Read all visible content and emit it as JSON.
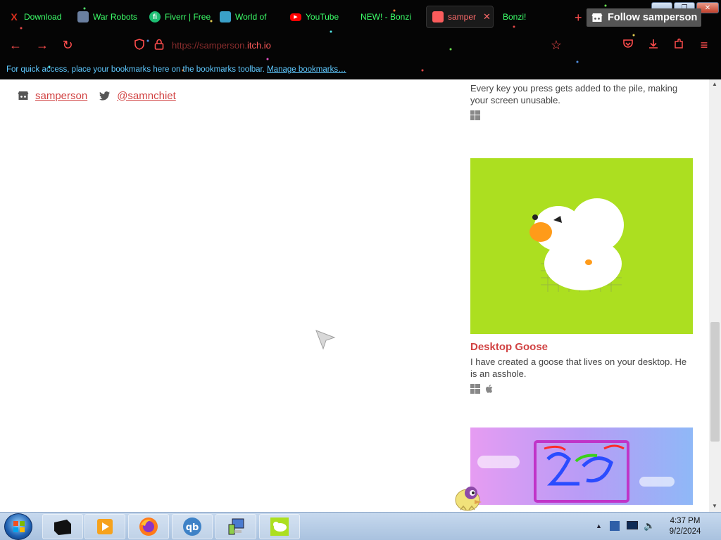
{
  "browser": {
    "tabs": [
      {
        "label": "Download",
        "icon": "x-icon",
        "icon_color": "#e0301e"
      },
      {
        "label": "War Robots",
        "icon": "war-robots-icon",
        "icon_color": "#6a7fa0"
      },
      {
        "label": "Fiverr | Free",
        "icon": "fiverr-icon",
        "icon_color": "#1dbf73"
      },
      {
        "label": "World of",
        "icon": "world-of-icon",
        "icon_color": "#3aa0c8"
      },
      {
        "label": "YouTube",
        "icon": "youtube-icon",
        "icon_color": "#ff0000"
      },
      {
        "label": "NEW! - Bonzi",
        "icon": "",
        "icon_color": ""
      },
      {
        "label": "samper",
        "icon": "itchio-icon",
        "icon_color": "#fa5c5c",
        "active": true
      },
      {
        "label": "Bonzi!",
        "icon": "",
        "icon_color": ""
      }
    ],
    "url_prefix": "https://samperson.",
    "url_domain": "itch.io",
    "bookmarks_hint": "For quick access, place your bookmarks here on the bookmarks toolbar.",
    "manage_bookmarks": "Manage bookmarks…",
    "accent_color": "#ff4d4d",
    "tab_text_color": "#3cff6a"
  },
  "profile": {
    "itch_name": "samperson",
    "twitter_handle": "@samnchiet",
    "follow_label": "Follow samperson",
    "link_color": "#d14343"
  },
  "games": [
    {
      "title": "",
      "description": "Every key you press gets added to the pile, making your screen unusable.",
      "platforms": [
        "windows"
      ]
    },
    {
      "title": "Desktop Goose",
      "description": "I have created a goose that lives on your desktop. He is an asshole.",
      "platforms": [
        "windows",
        "apple"
      ],
      "cover_color": "#acdf20"
    }
  ],
  "taskbar": {
    "time": "4:37 PM",
    "date": "9/2/2024",
    "apps": [
      "start-orb-icon",
      "terminal-icon",
      "media-player-icon",
      "firefox-icon",
      "qbittorrent-icon",
      "computer-icon",
      "desktop-goose-icon"
    ]
  }
}
